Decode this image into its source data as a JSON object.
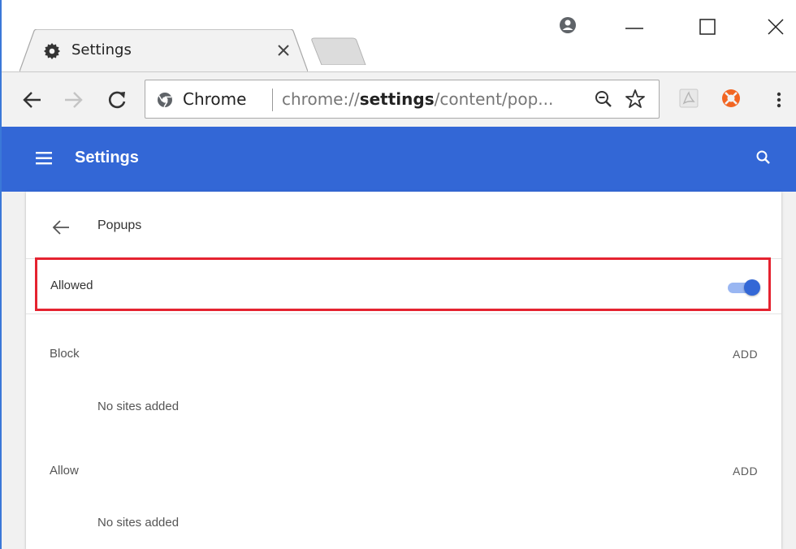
{
  "tab": {
    "title": "Settings"
  },
  "omnibox": {
    "site": "Chrome",
    "url_prefix": "chrome://",
    "url_host": "settings",
    "url_path": "/content/pop..."
  },
  "header": {
    "title": "Settings"
  },
  "page": {
    "title": "Popups",
    "allowed_label": "Allowed",
    "allowed_toggle_on": true,
    "sections": [
      {
        "label": "Block",
        "action": "ADD",
        "empty": "No sites added"
      },
      {
        "label": "Allow",
        "action": "ADD",
        "empty": "No sites added"
      }
    ]
  },
  "colors": {
    "header_bg": "#3367d6",
    "highlight_border": "#e52330",
    "toggle_track": "#99b6f2",
    "toggle_knob": "#3367d6",
    "extension_orange": "#f26522"
  },
  "icons": {
    "tab": "gear-icon",
    "tab_close": "close-icon",
    "profile": "profile-icon",
    "minimize": "minimize-icon",
    "maximize": "maximize-icon",
    "close_window": "close-icon",
    "back": "back-arrow-icon",
    "forward": "forward-arrow-icon",
    "reload": "reload-icon",
    "zoom": "zoom-out-icon",
    "bookmark": "star-icon",
    "menu": "kebab-menu-icon",
    "hamburger": "hamburger-menu-icon",
    "search": "search-icon"
  }
}
